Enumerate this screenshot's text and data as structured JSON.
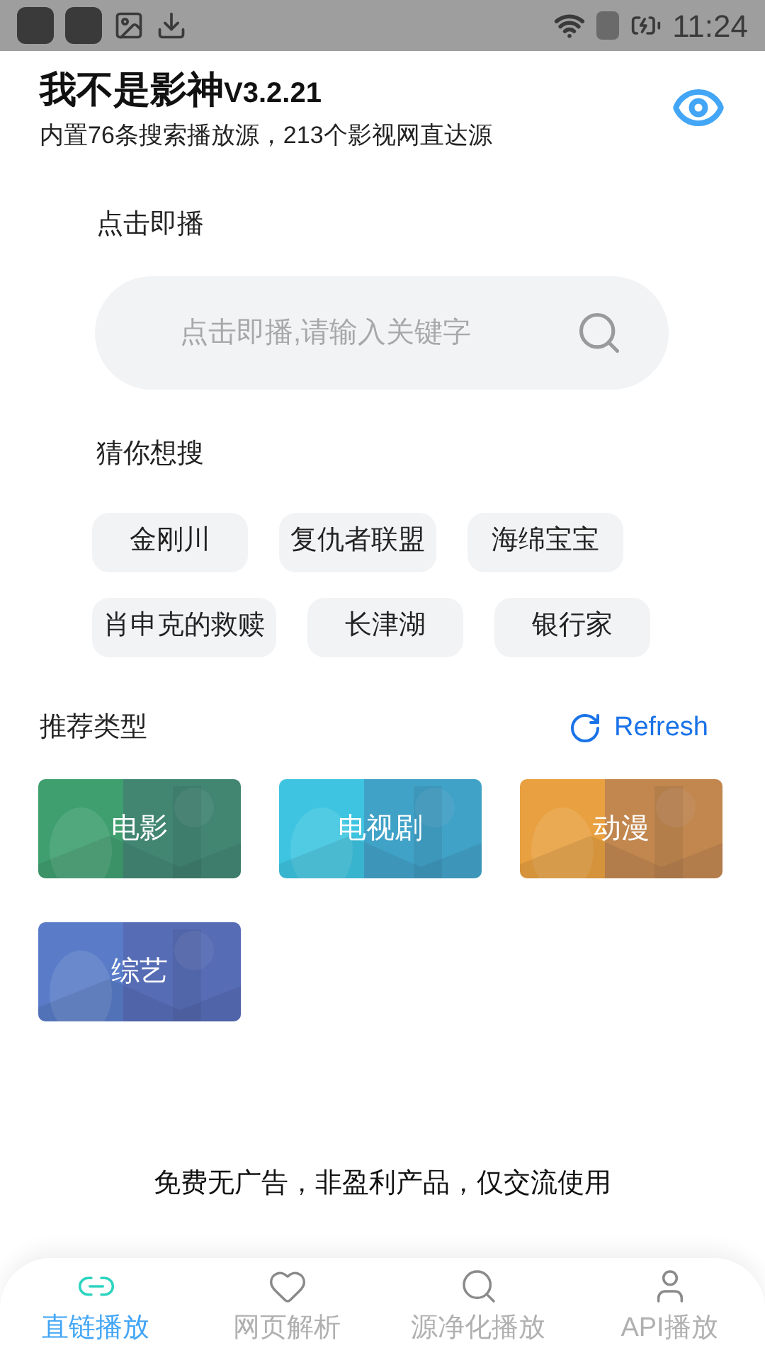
{
  "status_bar": {
    "time": "11:24"
  },
  "header": {
    "title": "我不是影神",
    "version": "V3.2.21",
    "subtitle": "内置76条搜索播放源，213个影视网直达源"
  },
  "search": {
    "label": "点击即播",
    "placeholder": "点击即播,请输入关键字"
  },
  "suggestions": {
    "label": "猜你想搜",
    "items": [
      {
        "text": "金刚川"
      },
      {
        "text": "复仇者联盟"
      },
      {
        "text": "海绵宝宝"
      },
      {
        "text": "肖申克的救赎"
      },
      {
        "text": "长津湖"
      },
      {
        "text": "银行家"
      }
    ]
  },
  "categories": {
    "label": "推荐类型",
    "refresh": "Refresh",
    "items": [
      {
        "text": "电影",
        "color": "#3f9f6f"
      },
      {
        "text": "电视剧",
        "color": "#3ec4e0"
      },
      {
        "text": "动漫",
        "color": "#e8a040"
      },
      {
        "text": "综艺",
        "color": "#5a7cc8"
      }
    ]
  },
  "footer_note": "免费无广告，非盈利产品，仅交流使用",
  "nav": [
    {
      "label": "直链播放",
      "kind": "link",
      "selected": true
    },
    {
      "label": "网页解析",
      "kind": "heart",
      "selected": false
    },
    {
      "label": "源净化播放",
      "kind": "search",
      "selected": false
    },
    {
      "label": "API播放",
      "kind": "user",
      "selected": false
    }
  ]
}
